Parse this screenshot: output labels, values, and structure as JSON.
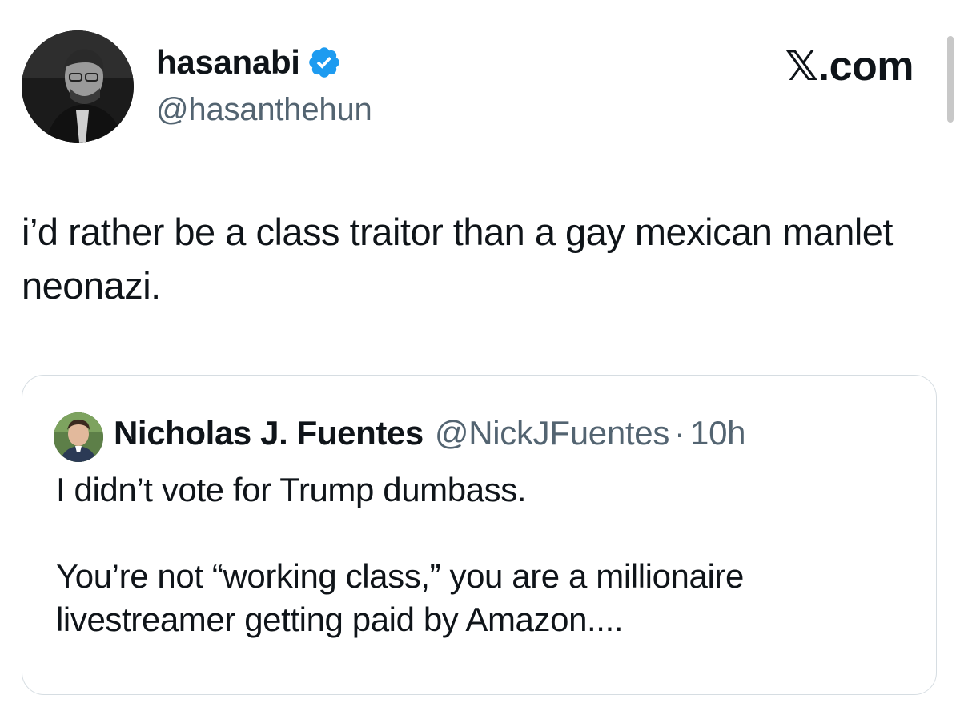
{
  "author": {
    "display_name": "hasanabi",
    "handle": "@hasanthehun",
    "verified_icon": "verified-badge-icon",
    "badge_color": "#1d9bf0"
  },
  "watermark": "𝕏.com",
  "tweet": {
    "text": "i’d rather be a class traitor than a gay mexican manlet neonazi."
  },
  "quoted_tweet": {
    "display_name": "Nicholas J. Fuentes",
    "handle": "@NickJFuentes",
    "separator": "·",
    "time": "10h",
    "paragraphs": [
      "I didn’t vote for Trump dumbass.",
      "You’re not “working class,” you are a millionaire livestreamer getting paid by Amazon...."
    ]
  },
  "colors": {
    "text": "#0f1419",
    "secondary_text": "#536471",
    "card_border": "#d6dde2"
  }
}
